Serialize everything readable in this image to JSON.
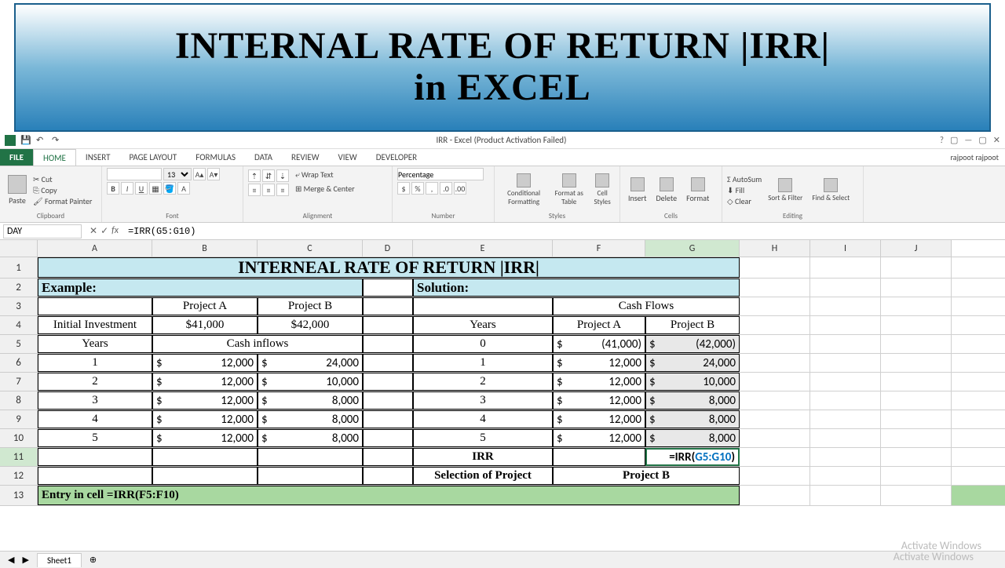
{
  "banner": {
    "line1": "INTERNAL RATE OF RETURN |IRR|",
    "line2": "in EXCEL"
  },
  "app_title": "IRR - Excel (Product Activation Failed)",
  "user": "rajpoot rajpoot",
  "ribbon_tabs": {
    "file": "FILE",
    "home": "HOME",
    "insert": "INSERT",
    "page": "PAGE LAYOUT",
    "formulas": "FORMULAS",
    "data": "DATA",
    "review": "REVIEW",
    "view": "VIEW",
    "developer": "DEVELOPER"
  },
  "ribbon": {
    "clipboard": {
      "cut": "Cut",
      "copy": "Copy",
      "painter": "Format Painter",
      "paste": "Paste",
      "label": "Clipboard"
    },
    "font": {
      "size": "13",
      "label": "Font"
    },
    "alignment": {
      "wrap": "Wrap Text",
      "merge": "Merge & Center",
      "label": "Alignment"
    },
    "number": {
      "format": "Percentage",
      "label": "Number"
    },
    "styles": {
      "cond": "Conditional Formatting",
      "table": "Format as Table",
      "cell": "Cell Styles",
      "label": "Styles"
    },
    "cells": {
      "insert": "Insert",
      "delete": "Delete",
      "format": "Format",
      "label": "Cells"
    },
    "editing": {
      "sum": "AutoSum",
      "fill": "Fill",
      "clear": "Clear",
      "sort": "Sort & Filter",
      "find": "Find & Select",
      "label": "Editing"
    }
  },
  "formula_bar": {
    "name": "DAY",
    "formula": "=IRR(G5:G10)"
  },
  "columns": [
    "A",
    "B",
    "C",
    "D",
    "E",
    "F",
    "G",
    "H",
    "I",
    "J"
  ],
  "rows": [
    "1",
    "2",
    "3",
    "4",
    "5",
    "6",
    "7",
    "8",
    "9",
    "10",
    "11",
    "12",
    "13"
  ],
  "sheet": {
    "title": "INTERNEAL RATE OF RETURN |IRR|",
    "example": "Example:",
    "solution": "Solution:",
    "projA": "Project A",
    "projB": "Project B",
    "init_inv": "Initial Investment",
    "invA": "$41,000",
    "invB": "$42,000",
    "years": "Years",
    "cash_inflows": "Cash inflows",
    "cash_flows": "Cash Flows",
    "irr_label": "IRR",
    "sel_proj": "Selection of Project",
    "sel_val": "Project B",
    "entry": "Entry in cell =IRR(F5:F10)",
    "g11_formula_pre": "=IRR(",
    "g11_formula_ref": "G5:G10",
    "g11_formula_post": ")",
    "left_rows": [
      {
        "y": "1",
        "a": "12,000",
        "b": "24,000"
      },
      {
        "y": "2",
        "a": "12,000",
        "b": "10,000"
      },
      {
        "y": "3",
        "a": "12,000",
        "b": "8,000"
      },
      {
        "y": "4",
        "a": "12,000",
        "b": "8,000"
      },
      {
        "y": "5",
        "a": "12,000",
        "b": "8,000"
      }
    ],
    "right_rows": [
      {
        "y": "0",
        "a": "(41,000)",
        "b": "(42,000)"
      },
      {
        "y": "1",
        "a": "12,000",
        "b": "24,000"
      },
      {
        "y": "2",
        "a": "12,000",
        "b": "10,000"
      },
      {
        "y": "3",
        "a": "12,000",
        "b": "8,000"
      },
      {
        "y": "4",
        "a": "12,000",
        "b": "8,000"
      },
      {
        "y": "5",
        "a": "12,000",
        "b": "8,000"
      }
    ]
  },
  "sheet_tab": "Sheet1",
  "watermark1": "Activate Windows",
  "watermark2": "Activate Windows"
}
